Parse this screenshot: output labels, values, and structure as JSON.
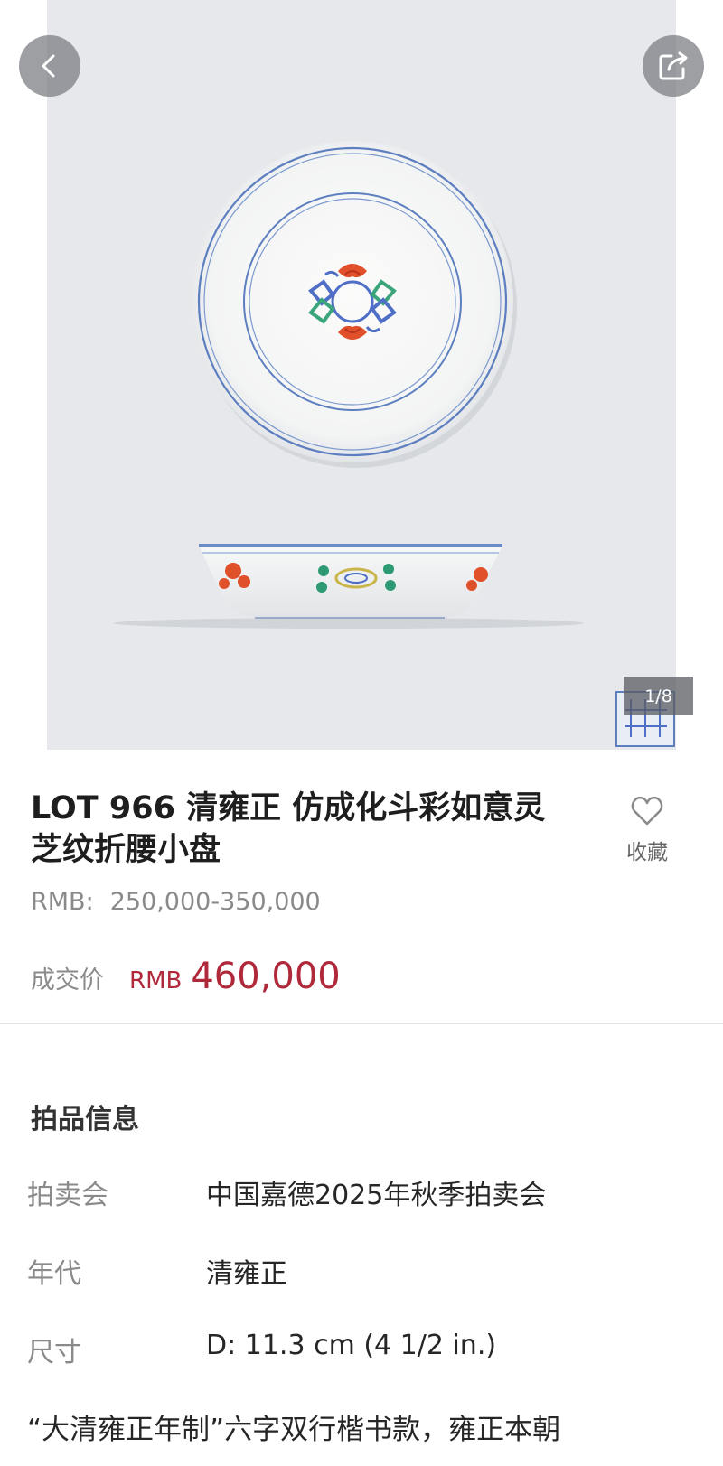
{
  "nav": {
    "back_icon": "chevron-left-icon",
    "share_icon": "share-icon"
  },
  "gallery": {
    "counter": "1/8"
  },
  "lot": {
    "title": "LOT 966 清雍正  仿成化斗彩如意灵芝纹折腰小盘",
    "estimate_currency": "RMB:",
    "estimate_range": "250,000-350,000",
    "sold_label": "成交价",
    "sold_currency": "RMB",
    "sold_price": "460,000"
  },
  "favorite": {
    "icon": "heart-icon",
    "label": "收藏"
  },
  "info": {
    "section_title": "拍品信息",
    "rows": [
      {
        "key": "拍卖会",
        "value": "中国嘉德2025年秋季拍卖会"
      },
      {
        "key": "年代",
        "value": "清雍正"
      },
      {
        "key": "尺寸",
        "value": "D: 11.3 cm (4 1/2 in.)"
      }
    ],
    "description": "“大清雍正年制”六字双行楷书款，雍正本朝"
  },
  "colors": {
    "price_red": "#b0293b",
    "photo_bg": "#e6e8ec",
    "muted_text": "#8a8a8a"
  }
}
